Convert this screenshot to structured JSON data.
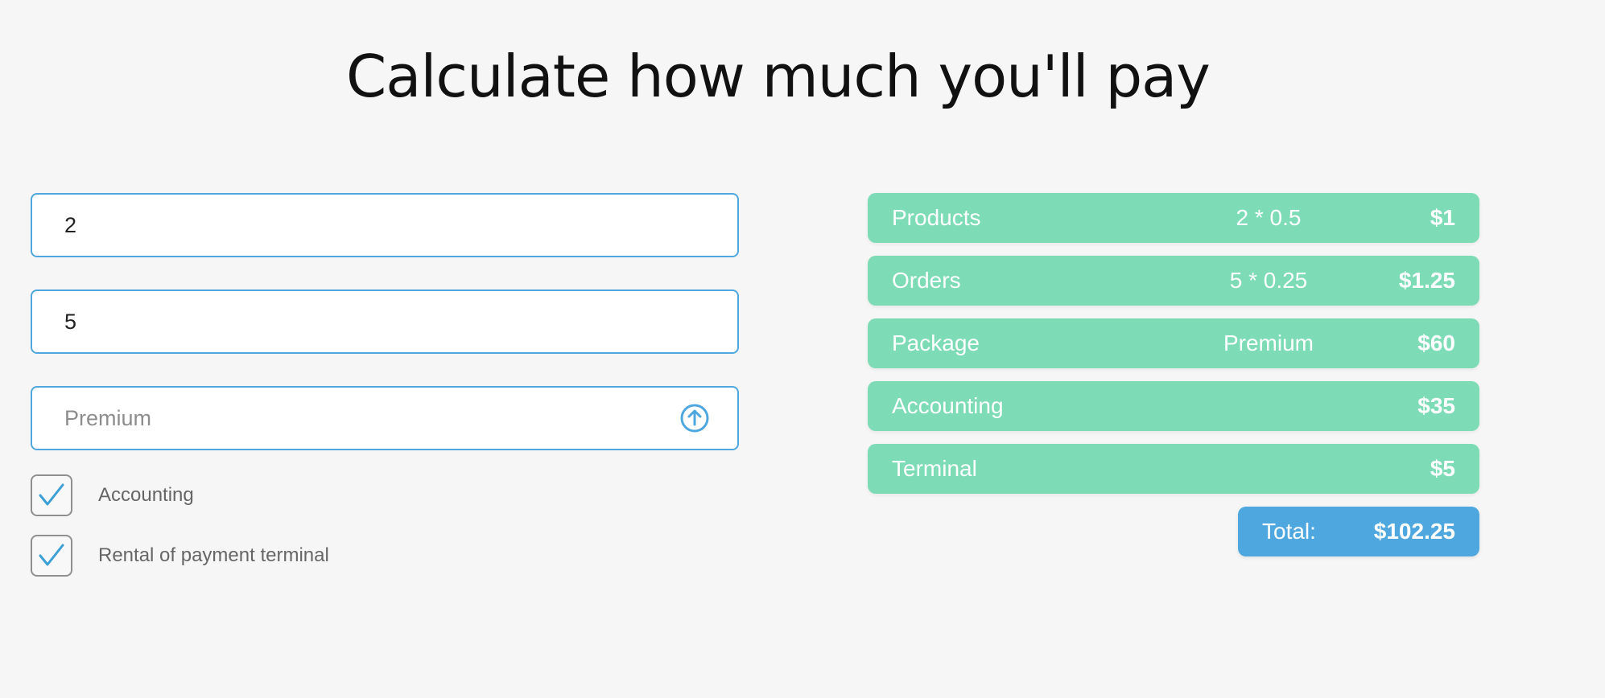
{
  "page": {
    "title": "Calculate how much you'll pay"
  },
  "form": {
    "products_value": "2",
    "orders_value": "5",
    "package_placeholder": "Premium",
    "package_icon": "arrow-up-circle-icon",
    "checkboxes": [
      {
        "label": "Accounting",
        "checked": true
      },
      {
        "label": "Rental of payment terminal",
        "checked": true
      }
    ]
  },
  "summary": {
    "rows": [
      {
        "name": "Products",
        "calc": "2 * 0.5",
        "price": "$1"
      },
      {
        "name": "Orders",
        "calc": "5 * 0.25",
        "price": "$1.25"
      },
      {
        "name": "Package",
        "calc": "Premium",
        "price": "$60"
      },
      {
        "name": "Accounting",
        "calc": "",
        "price": "$35"
      },
      {
        "name": "Terminal",
        "calc": "",
        "price": "$5"
      }
    ],
    "total_label": "Total:",
    "total_value": "$102.25"
  },
  "colors": {
    "background": "#f6f6f6",
    "accent_blue": "#4ea7df",
    "summary_green": "#7ddcb6",
    "checkmark": "#3c9fd6"
  }
}
